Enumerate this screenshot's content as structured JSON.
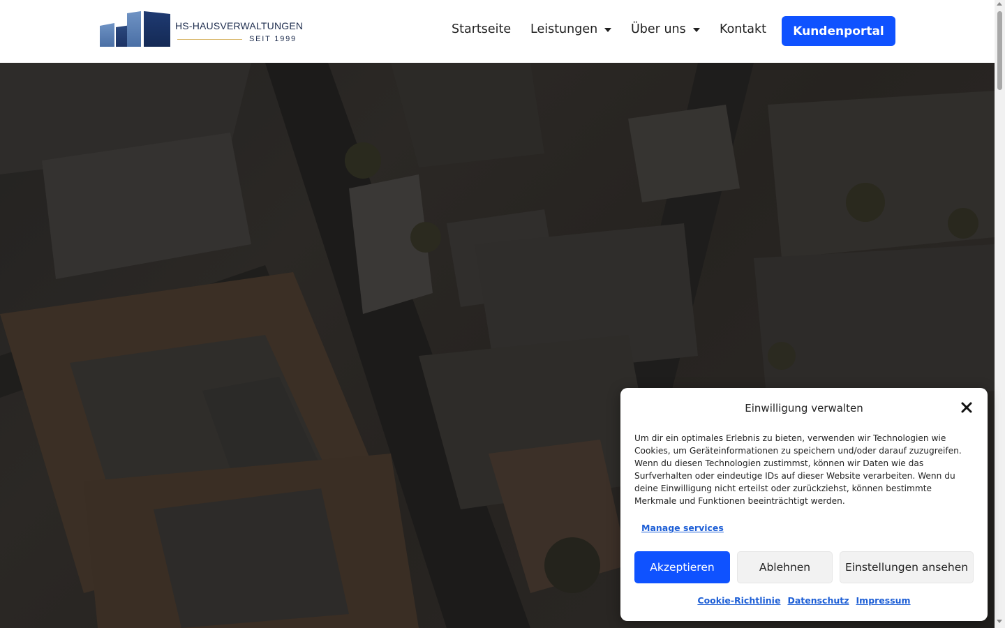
{
  "header": {
    "logo": {
      "name": "HS-HAUSVERWALTUNGEN",
      "tagline": "SEIT 1999"
    },
    "nav": [
      {
        "label": "Startseite",
        "has_dropdown": false
      },
      {
        "label": "Leistungen",
        "has_dropdown": true
      },
      {
        "label": "Über uns",
        "has_dropdown": true
      },
      {
        "label": "Kontakt",
        "has_dropdown": false
      }
    ],
    "portal_button": "Kundenportal"
  },
  "hero": {
    "background": "aerial-city-photo-darkened"
  },
  "cookie_dialog": {
    "title": "Einwilligung verwalten",
    "body": "Um dir ein optimales Erlebnis zu bieten, verwenden wir Technologien wie Cookies, um Geräteinformationen zu speichern und/oder darauf zuzugreifen. Wenn du diesen Technologien zustimmst, können wir Daten wie das Surfverhalten oder eindeutige IDs auf dieser Website verarbeiten. Wenn du deine Einwilligung nicht erteilst oder zurückziehst, können bestimmte Merkmale und Funktionen beeinträchtigt werden.",
    "manage_link": "Manage services",
    "buttons": {
      "accept": "Akzeptieren",
      "deny": "Ablehnen",
      "preferences": "Einstellungen ansehen"
    },
    "links": [
      "Cookie-Richtlinie",
      "Datenschutz",
      "Impressum"
    ]
  },
  "colors": {
    "accent": "#0f52ff",
    "brand_navy": "#1d2c4d",
    "link": "#1e5fd6",
    "logo_gold": "#d9b76a"
  },
  "icons": {
    "close": "close-icon",
    "dropdown": "caret-down-icon"
  }
}
